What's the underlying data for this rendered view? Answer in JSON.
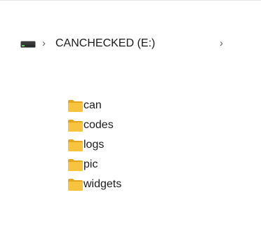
{
  "address_bar": {
    "drive_icon": "drive-icon",
    "separator": "›",
    "crumbs": [
      {
        "label": "CANCHECKED (E:)"
      }
    ]
  },
  "folders": [
    {
      "name": "can",
      "icon": "folder-icon"
    },
    {
      "name": "codes",
      "icon": "folder-icon"
    },
    {
      "name": "logs",
      "icon": "folder-icon"
    },
    {
      "name": "pic",
      "icon": "folder-icon"
    },
    {
      "name": "widgets",
      "icon": "folder-icon"
    }
  ],
  "colors": {
    "folder_yellow": "#f8c33f",
    "folder_dark": "#e4a51f",
    "text": "#1b1b1b",
    "chevron": "#5f5f5f"
  }
}
